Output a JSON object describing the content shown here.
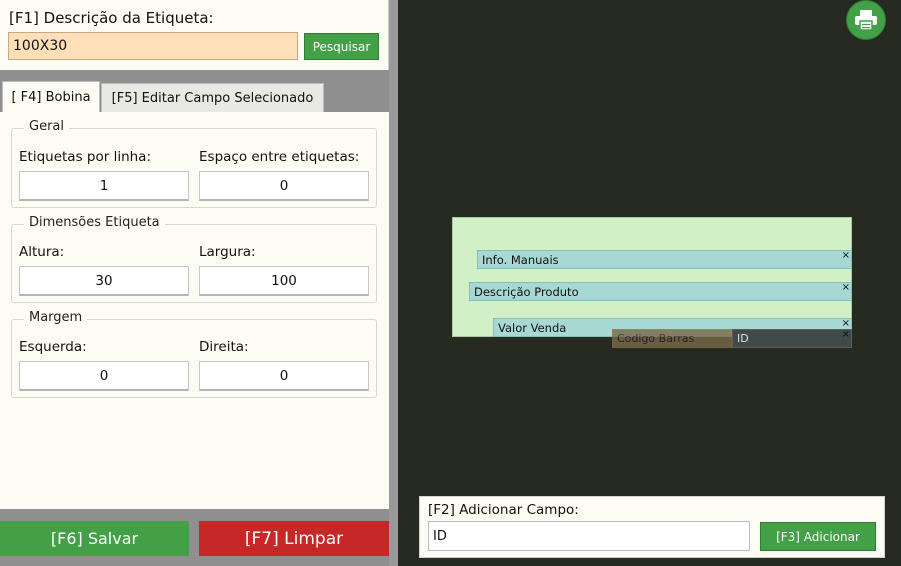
{
  "description": {
    "label": "[F1] Descrição da Etiqueta:",
    "value": "100X30",
    "search_button": "Pesquisar"
  },
  "tabs": [
    {
      "label": "[ F4] Bobina",
      "active": true
    },
    {
      "label": "[F5] Editar Campo Selecionado",
      "active": false
    }
  ],
  "groups": {
    "geral": {
      "title": "Geral",
      "labels_per_line_label": "Etiquetas por linha:",
      "labels_per_line_value": "1",
      "spacing_label": "Espaço entre etiquetas:",
      "spacing_value": "0"
    },
    "dimensoes": {
      "title": "Dimensões Etiqueta",
      "height_label": "Altura:",
      "height_value": "30",
      "width_label": "Largura:",
      "width_value": "100"
    },
    "margem": {
      "title": "Margem",
      "left_label": "Esquerda:",
      "left_value": "0",
      "right_label": "Direita:",
      "right_value": "0"
    }
  },
  "buttons": {
    "save": "[F6] Salvar",
    "clear": "[F7] Limpar"
  },
  "canvas": {
    "fields": [
      {
        "label": "Info. Manuais"
      },
      {
        "label": "Descrição Produto"
      },
      {
        "label": "Valor Venda"
      },
      {
        "label": "Codigo Barras"
      },
      {
        "label": "ID"
      }
    ],
    "close_glyph": "×"
  },
  "add_field": {
    "label": "[F2] Adicionar Campo:",
    "value": "ID",
    "button": "[F3] Adicionar"
  },
  "colors": {
    "accent_green": "#43a047",
    "danger_red": "#c62828",
    "canvas_bg": "#272a21",
    "label_bg": "#d2f0c8",
    "field_bg": "#a7d8d4",
    "input_highlight": "#ffdfb8"
  },
  "icons": {
    "print": "printer-icon"
  }
}
